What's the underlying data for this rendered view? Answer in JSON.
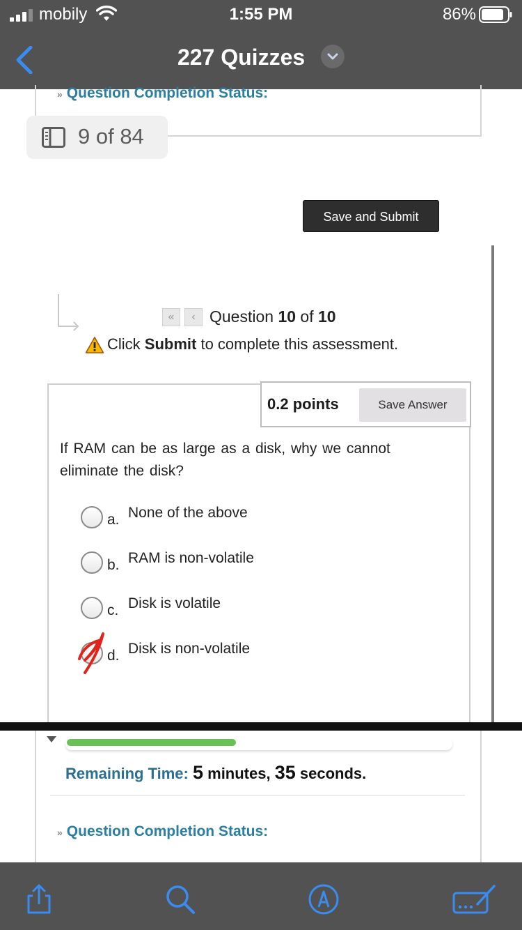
{
  "status_bar": {
    "carrier": "mobily",
    "time": "1:55 PM",
    "battery_percent": "86%",
    "signal_icon": "signal-bars-icon",
    "wifi_icon": "wifi-icon",
    "battery_level": 0.86
  },
  "nav": {
    "title": "227 Quizzes",
    "back_icon": "chevron-left-icon",
    "dropdown_icon": "chevron-down-icon"
  },
  "top_section": {
    "completion_status_label": "Question Completion Status:",
    "page_indicator": "9 of 84"
  },
  "actions": {
    "save_and_submit": "Save and Submit"
  },
  "question_nav": {
    "first_icon": "double-chevron-left-icon",
    "prev_icon": "chevron-left-icon",
    "prefix": "Question ",
    "current": "10",
    "of": " of ",
    "total": "10",
    "warning_prefix": "Click ",
    "warning_bold": "Submit",
    "warning_suffix": " to complete this assessment."
  },
  "question": {
    "points": "0.2 points",
    "save_answer": "Save Answer",
    "text": "If RAM can be as large as a disk,  why we cannot eliminate the disk?",
    "options": [
      {
        "letter": "a.",
        "text": "None of the above",
        "selected": false
      },
      {
        "letter": "b.",
        "text": "RAM is non-volatile",
        "selected": false
      },
      {
        "letter": "c.",
        "text": "Disk is volatile",
        "selected": false
      },
      {
        "letter": "d.",
        "text": "Disk is non-volatile",
        "selected": true
      }
    ]
  },
  "timer": {
    "label": "Remaining Time:",
    "minutes": "5",
    "minutes_unit": " minutes, ",
    "seconds": "35",
    "seconds_unit": " seconds.",
    "progress": 0.44
  },
  "bottom_section": {
    "completion_status_label": "Question Completion Status:"
  },
  "toolbar": {
    "items": [
      "share-icon",
      "search-icon",
      "markup-icon",
      "keyboard-edit-icon"
    ]
  },
  "colors": {
    "bar_bg": "#525252",
    "ios_blue": "#3a8cf0",
    "link_teal": "#2a7ea0",
    "progress_green": "#6cc05a",
    "scribble_red": "#e0241b"
  }
}
